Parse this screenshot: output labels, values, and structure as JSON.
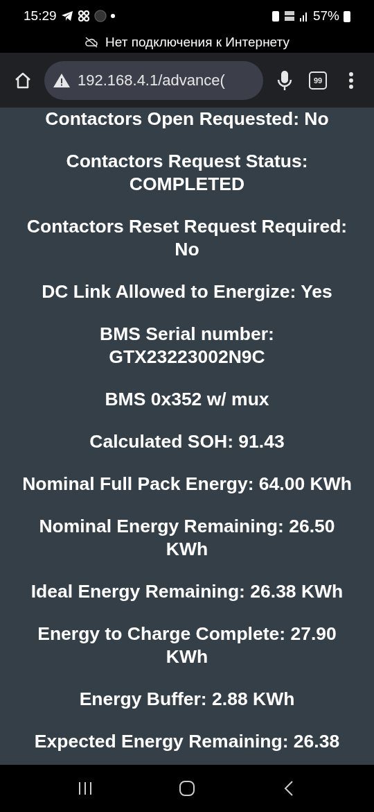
{
  "status_bar": {
    "time": "15:29",
    "battery": "57%"
  },
  "offline_banner": {
    "text": "Нет подключения к Интернету"
  },
  "browser_toolbar": {
    "url": "192.168.4.1/advance(",
    "tab_count": "99"
  },
  "page": {
    "items": [
      {
        "text": "Contactors Open Requested: No"
      },
      {
        "text": "Contactors Request Status: COMPLETED"
      },
      {
        "text": "Contactors Reset Request Required: No"
      },
      {
        "text": "DC Link Allowed to Energize: Yes"
      },
      {
        "text": "BMS Serial number: GTX23223002N9C"
      },
      {
        "text": "BMS 0x352 w/ mux"
      },
      {
        "text": "Calculated SOH: 91.43"
      },
      {
        "text": "Nominal Full Pack Energy: 64.00 KWh"
      },
      {
        "text": "Nominal Energy Remaining: 26.50 KWh"
      },
      {
        "text": "Ideal Energy Remaining: 26.38 KWh"
      },
      {
        "text": "Energy to Charge Complete: 27.90 KWh"
      },
      {
        "text": "Energy Buffer: 2.88 KWh"
      },
      {
        "text": "Expected Energy Remaining: 26.38"
      }
    ]
  }
}
